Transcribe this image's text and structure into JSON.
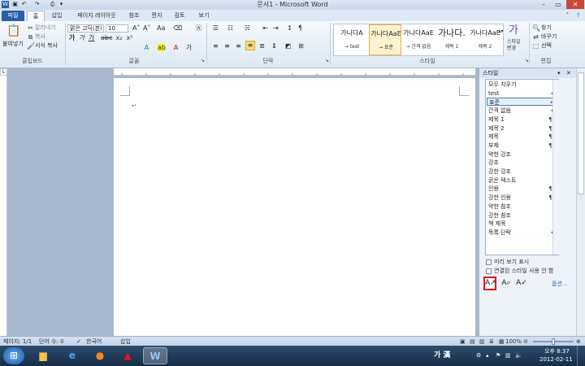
{
  "titlebar": {
    "title": "문서1 - Microsoft Word"
  },
  "tabs": [
    "파일",
    "홈",
    "삽입",
    "페이지 레이아웃",
    "참조",
    "편지",
    "검토",
    "보기"
  ],
  "ribbon": {
    "clipboard": {
      "label": "클립보드",
      "paste": "붙여넣기",
      "cut": "잘라내기",
      "copy": "복사",
      "format_painter": "서식 복사"
    },
    "font": {
      "label": "글꼴",
      "font_name": "맑은 고딕(본)",
      "font_size": "10"
    },
    "paragraph": {
      "label": "단락"
    },
    "styles": {
      "label": "스타일",
      "gallery": [
        {
          "sample": "가나다A",
          "name": "→ test"
        },
        {
          "sample": "가나다AaE",
          "name": "→ 표준"
        },
        {
          "sample": "가나다AaE",
          "name": "→ 간격 없음"
        },
        {
          "sample": "가나다.",
          "name": "제목 1"
        },
        {
          "sample": "가나다AaE",
          "name": "제목 2"
        }
      ],
      "change_styles": "스타일 변경"
    },
    "editing": {
      "label": "편집",
      "find": "찾기",
      "replace": "바꾸기",
      "select": "선택"
    }
  },
  "styles_pane": {
    "title": "스타일",
    "items": [
      {
        "name": "모두 지우기",
        "mark": ""
      },
      {
        "name": "test",
        "mark": "↵"
      },
      {
        "name": "표준",
        "mark": "↵"
      },
      {
        "name": "간격 없음",
        "mark": "↵"
      },
      {
        "name": "제목 1",
        "mark": "¶a"
      },
      {
        "name": "제목 2",
        "mark": "¶a"
      },
      {
        "name": "제목",
        "mark": "¶a"
      },
      {
        "name": "부제",
        "mark": "¶a"
      },
      {
        "name": "약한 강조",
        "mark": "a"
      },
      {
        "name": "강조",
        "mark": "a"
      },
      {
        "name": "강한 강조",
        "mark": "a"
      },
      {
        "name": "굵은 텍스트",
        "mark": "a"
      },
      {
        "name": "인용",
        "mark": "¶a"
      },
      {
        "name": "강한 인용",
        "mark": "¶a"
      },
      {
        "name": "약한 참조",
        "mark": "a"
      },
      {
        "name": "강한 참조",
        "mark": "a"
      },
      {
        "name": "책 제목",
        "mark": "a"
      },
      {
        "name": "목록 단락",
        "mark": "↵"
      }
    ],
    "selected_index": 2,
    "show_preview": "미리 보기 표시",
    "disable_linked": "연결된 스타일 사용 안 함",
    "options": "옵션..."
  },
  "statusbar": {
    "page": "페이지: 1/1",
    "words": "단어 수: 0",
    "language": "한국어",
    "mode": "삽입",
    "zoom": "100%"
  },
  "taskbar": {
    "ime": "가 漢",
    "ampm": "오후 8:37",
    "date": "2012-02-11"
  }
}
